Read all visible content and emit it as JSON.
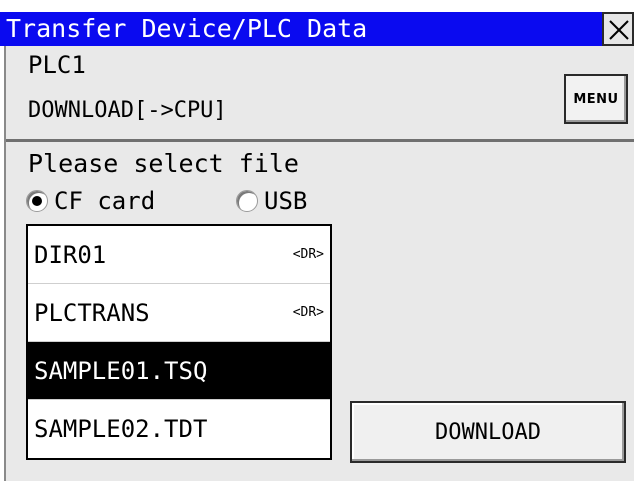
{
  "window": {
    "title": "Transfer Device/PLC Data",
    "close_icon": "close-icon"
  },
  "header": {
    "device": "PLC1",
    "operation": "DOWNLOAD[->CPU]",
    "menu_label": "MENU"
  },
  "selection": {
    "prompt": "Please select file",
    "sources": [
      {
        "label": "CF card",
        "selected": true
      },
      {
        "label": "USB",
        "selected": false
      }
    ]
  },
  "files": [
    {
      "name": "DIR01",
      "tag": "<DR>",
      "selected": false
    },
    {
      "name": "PLCTRANS",
      "tag": "<DR>",
      "selected": false
    },
    {
      "name": "SAMPLE01.TSQ",
      "tag": "",
      "selected": true
    },
    {
      "name": "SAMPLE02.TDT",
      "tag": "",
      "selected": false
    }
  ],
  "actions": {
    "download_label": "DOWNLOAD"
  },
  "colors": {
    "titlebar": "#0a0af0",
    "panel": "#e9e9e9",
    "selected_row": "#000000"
  }
}
